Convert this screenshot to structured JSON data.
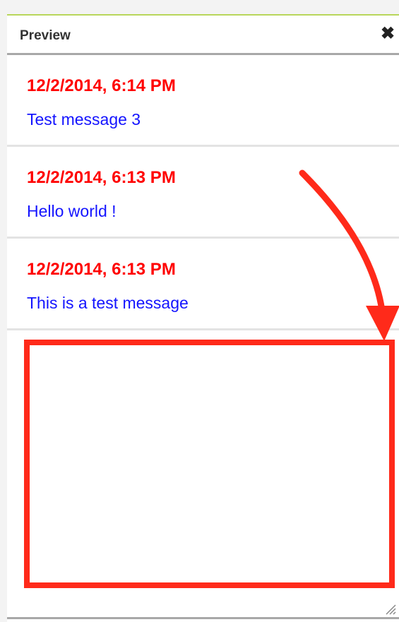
{
  "panel": {
    "title": "Preview",
    "close_icon": "close-icon",
    "close_glyph": "✖"
  },
  "messages": [
    {
      "timestamp": "12/2/2014, 6:14 PM",
      "text": "Test message 3"
    },
    {
      "timestamp": "12/2/2014, 6:13 PM",
      "text": "Hello world !"
    },
    {
      "timestamp": "12/2/2014, 6:13 PM",
      "text": "This is a test message"
    }
  ],
  "annotation": {
    "color": "#ff2a1a",
    "arrow_icon": "curved-arrow-icon",
    "box": "highlight-box"
  },
  "colors": {
    "timestamp": "#ff0000",
    "message_text": "#1414ff",
    "header_accent": "#b8d65a"
  },
  "resize_icon": "resize-grip-icon"
}
